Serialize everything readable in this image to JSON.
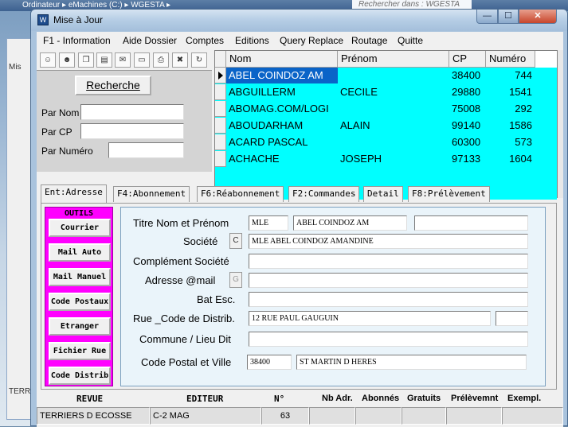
{
  "background": {
    "breadcrumb": "Ordinateur ▸ eMachines (C:) ▸ WGESTA ▸",
    "search_placeholder": "Rechercher dans : WGESTA",
    "left_items": [
      "Mis",
      "TERRI"
    ]
  },
  "window": {
    "title": "Mise à Jour",
    "min_label": "—",
    "max_label": "☐",
    "close_label": "✕"
  },
  "menu": [
    "F1 - Information",
    "Aide Dossier",
    "Comptes",
    "Editions",
    "Query Replace",
    "Routage",
    "Quitte"
  ],
  "search": {
    "button": "Recherche",
    "labels": [
      "Par Nom",
      "Par CP",
      "Par Numéro"
    ]
  },
  "grid": {
    "headers": [
      "Nom",
      "Prénom",
      "CP",
      "Numéro"
    ],
    "rows": [
      {
        "nom": "ABEL COINDOZ AM",
        "prenom": "",
        "cp": "38400",
        "numero": "744"
      },
      {
        "nom": "ABGUILLERM",
        "prenom": "CECILE",
        "cp": "29880",
        "numero": "1541"
      },
      {
        "nom": "ABOMAG.COM/LOGI",
        "prenom": "",
        "cp": "75008",
        "numero": "292"
      },
      {
        "nom": "ABOUDARHAM",
        "prenom": "ALAIN",
        "cp": "99140",
        "numero": "1586"
      },
      {
        "nom": "ACARD PASCAL",
        "prenom": "",
        "cp": "60300",
        "numero": "573"
      },
      {
        "nom": "ACHACHE",
        "prenom": "JOSEPH",
        "cp": "97133",
        "numero": "1604"
      }
    ]
  },
  "tabs": [
    "Ent:Adresse",
    "F4:Abonnement",
    "F6:Réabonnement",
    "F2:Commandes",
    "Detail",
    "F8:Prélèvement"
  ],
  "outils": {
    "title": "OUTILS",
    "buttons": [
      "Courrier",
      "Mail Auto",
      "Mail Manuel",
      "Code Postaux",
      "Etranger",
      "Fichier Rue",
      "Code Distrib"
    ]
  },
  "form": {
    "labels": {
      "titre": "Titre Nom et Prénom",
      "societe": "Société",
      "complement": "Complément Société",
      "mail": "Adresse @mail",
      "bat": "Bat Esc.",
      "rue": "Rue _Code de Distrib.",
      "commune": "Commune / Lieu Dit",
      "cpville": "Code Postal et Ville"
    },
    "values": {
      "titre": "MLE",
      "nom": "ABEL COINDOZ AM",
      "prenom": "",
      "societe": "MLE ABEL COINDOZ AMANDINE",
      "complement": "",
      "mail": "",
      "bat": "",
      "rue": "12 RUE PAUL GAUGUIN",
      "rue_code": "",
      "commune": "",
      "cp": "38400",
      "ville": "ST MARTIN D HERES"
    },
    "societe_btn": "C",
    "mail_btn": "G"
  },
  "bottom": {
    "headers": [
      "REVUE",
      "EDITEUR",
      "N°",
      "Nb Adr.",
      "Abonnés",
      "Gratuits",
      "Prélèvemnt",
      "Exempl."
    ],
    "row": [
      "TERRIERS D ECOSSE",
      "C-2 MAG",
      "63",
      "",
      "",
      "",
      "",
      ""
    ]
  },
  "colors": {
    "grid_bg": "#00ffff",
    "selected": "#0a64c8",
    "outils_bg": "#ff00ff"
  }
}
